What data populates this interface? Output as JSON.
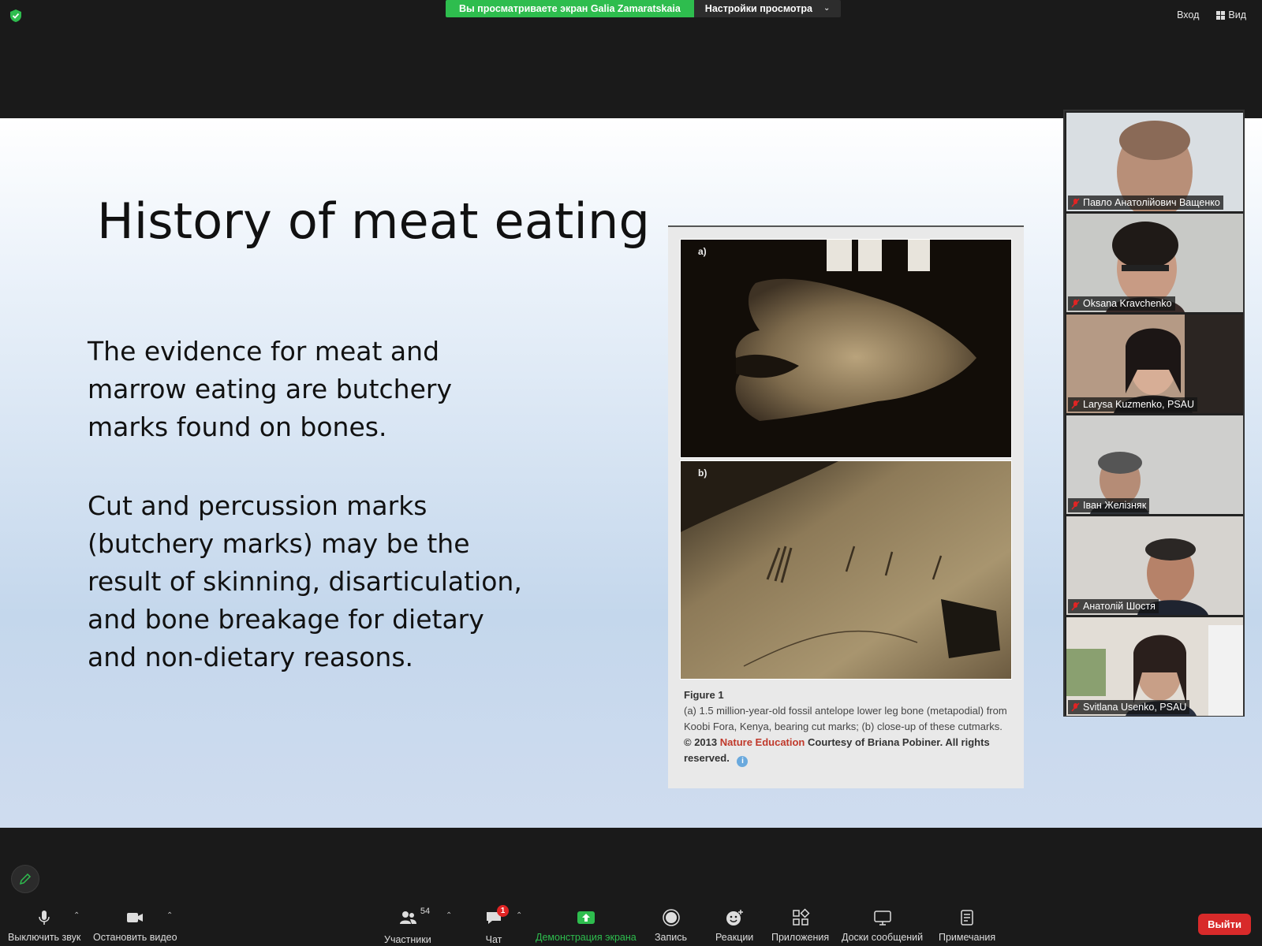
{
  "topbar": {
    "share_text": "Вы просматриваете экран Galia Zamaratskaia",
    "view_options": "Настройки просмотра",
    "enter_label": "Вход",
    "view_label": "Вид"
  },
  "slide": {
    "title": "History of meat eating",
    "paragraph1": "The evidence for meat and marrow eating are butchery marks found on bones.",
    "paragraph2": "Cut and percussion marks (butchery marks) may be the result of skinning, disarticulation, and bone breakage for dietary and non-dietary reasons.",
    "figure": {
      "label_a": "a)",
      "label_b": "b)",
      "caption_title": "Figure 1",
      "caption_text": "(a) 1.5 million-year-old fossil antelope lower leg bone (metapodial) from Koobi Fora, Kenya, bearing cut marks; (b) close-up of these cutmarks.",
      "copyright_prefix": "© 2013",
      "copyright_org": "Nature Education",
      "copyright_suffix": "Courtesy of Briana Pobiner. All rights reserved."
    }
  },
  "participants": [
    {
      "name": "Павло Анатолійович Ващенко"
    },
    {
      "name": "Oksana Kravchenko"
    },
    {
      "name": "Larysa Kuzmenko, PSAU"
    },
    {
      "name": "Іван Желізняк"
    },
    {
      "name": "Анатолій Шостя"
    },
    {
      "name": "Svitlana Usenko, PSAU"
    }
  ],
  "toolbar": {
    "mute": "Выключить звук",
    "stop_video": "Остановить видео",
    "participants": "Участники",
    "participants_count": "54",
    "chat": "Чат",
    "chat_badge": "1",
    "share_screen": "Демонстрация экрана",
    "record": "Запись",
    "reactions": "Реакции",
    "apps": "Приложения",
    "whiteboards": "Доски сообщений",
    "notes": "Примечания",
    "leave": "Выйти"
  },
  "colors": {
    "share_green": "#2ebd4e",
    "leave_red": "#d82a2a",
    "background": "#1a1a1a"
  }
}
